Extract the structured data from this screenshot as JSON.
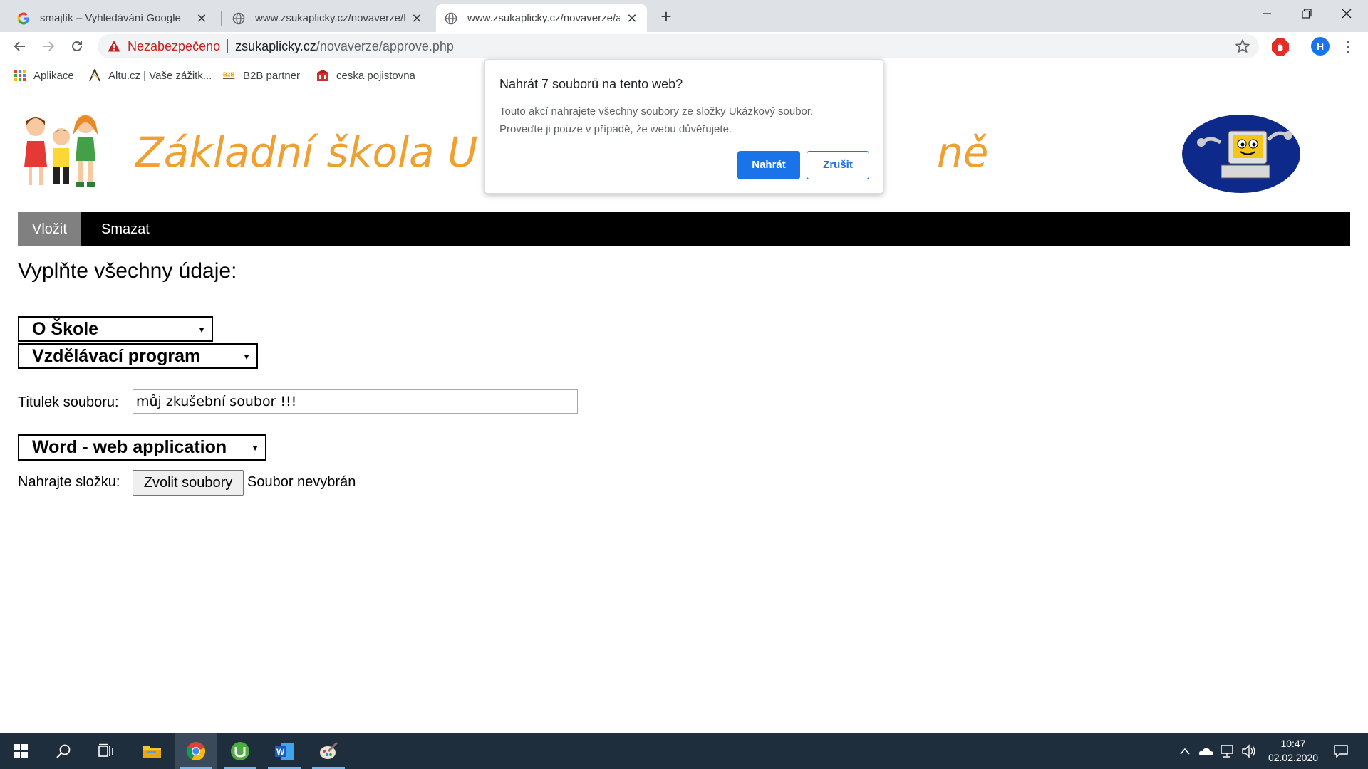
{
  "browser": {
    "tabs": [
      {
        "title": "smajlík – Vyhledávání Google",
        "favicon": "google-icon"
      },
      {
        "title": "www.zsukaplicky.cz/novaverze/RUpl",
        "favicon": "globe-icon"
      },
      {
        "title": "www.zsukaplicky.cz/novaverze/approve",
        "favicon": "globe-icon"
      }
    ],
    "address": {
      "security_label": "Nezabezpečeno",
      "host": "zsukaplicky.cz",
      "path": "/novaverze/approve.php"
    },
    "profile_initial": "H",
    "bookmarks": [
      {
        "label": "Aplikace",
        "icon": "apps-grid-icon"
      },
      {
        "label": "Altu.cz | Vaše zážitk...",
        "icon": "altu-icon"
      },
      {
        "label": "B2B partner",
        "icon": "b2b-icon"
      },
      {
        "label": "ceska pojistovna",
        "icon": "pojistovna-icon"
      }
    ]
  },
  "dialog": {
    "title": "Nahrát 7 souborů na tento web?",
    "body_line1": "Touto akcí nahrajete všechny soubory ze složky Ukázkový soubor.",
    "body_line2": "Proveďte ji pouze v případě, že webu důvěřujete.",
    "confirm_label": "Nahrát",
    "cancel_label": "Zrušit"
  },
  "page": {
    "school_title": "Základní škola U Kaplicky Praze Kamýk, Ke Kaplicce, Kamýk, Zásmuky, Kolíně",
    "school_title_visible_left": "Základní škola U K",
    "school_title_visible_right": "ně",
    "nav": [
      {
        "label": "Vložit",
        "active": true
      },
      {
        "label": "Smazat",
        "active": false
      }
    ],
    "heading": "Vyplňte všechny údaje:",
    "select_section": "O Škole",
    "select_subsection": "Vzdělávací program",
    "title_label": "Titulek souboru:",
    "title_value": "můj zkušební soubor !!!",
    "select_type": "Word - web application",
    "upload_label": "Nahrajte složku:",
    "upload_button": "Zvolit soubory",
    "upload_status": "Soubor nevybrán"
  },
  "taskbar": {
    "apps": [
      "start-icon",
      "search-icon",
      "task-view-icon",
      "file-explorer-icon",
      "chrome-icon",
      "utorrent-icon",
      "word-icon",
      "paint-icon"
    ],
    "clock_time": "10:47",
    "clock_date": "02.02.2020"
  },
  "colors": {
    "accent": "#1a73e8",
    "school_title": "#f0a030",
    "navbar": "#000000",
    "nav_active": "#808080",
    "insecure": "#c5221f",
    "taskbar": "#1f2e3d"
  }
}
